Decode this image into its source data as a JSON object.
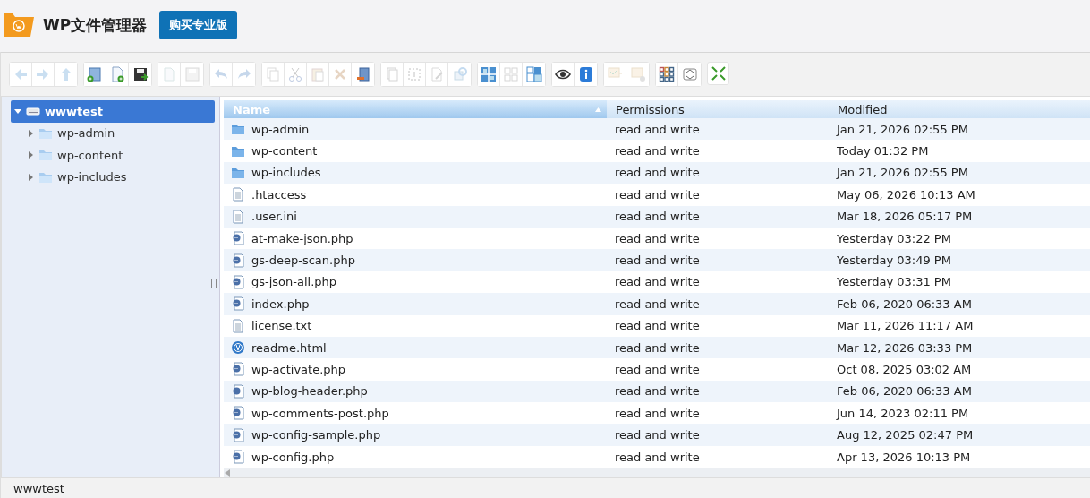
{
  "app": {
    "title": "WP文件管理器",
    "upgrade_button": "购买专业版"
  },
  "toolbar": [
    [
      {
        "kind": "back",
        "disabled": true
      },
      {
        "kind": "forward",
        "disabled": true
      },
      {
        "kind": "up",
        "disabled": true
      }
    ],
    [
      {
        "kind": "new-folder",
        "disabled": false
      },
      {
        "kind": "new-file",
        "disabled": false
      },
      {
        "kind": "save",
        "disabled": false
      }
    ],
    [
      {
        "kind": "open",
        "disabled": true
      },
      {
        "kind": "download",
        "disabled": true
      }
    ],
    [
      {
        "kind": "undo",
        "disabled": true
      },
      {
        "kind": "redo",
        "disabled": true
      }
    ],
    [
      {
        "kind": "copy",
        "disabled": true
      },
      {
        "kind": "cut",
        "disabled": true
      },
      {
        "kind": "paste",
        "disabled": true
      },
      {
        "kind": "delete",
        "disabled": true
      },
      {
        "kind": "empty",
        "disabled": false
      }
    ],
    [
      {
        "kind": "duplicate",
        "disabled": true
      },
      {
        "kind": "select",
        "disabled": true
      },
      {
        "kind": "edit",
        "disabled": true
      },
      {
        "kind": "resize",
        "disabled": true
      }
    ],
    [
      {
        "kind": "icons",
        "disabled": false
      },
      {
        "kind": "deselect",
        "disabled": true
      },
      {
        "kind": "invert",
        "disabled": false
      }
    ],
    [
      {
        "kind": "view",
        "disabled": false
      },
      {
        "kind": "info",
        "disabled": false
      }
    ],
    [
      {
        "kind": "extract",
        "disabled": true
      },
      {
        "kind": "archive",
        "disabled": true
      }
    ],
    [
      {
        "kind": "grid",
        "disabled": false
      },
      {
        "kind": "sort",
        "disabled": false
      }
    ],
    [
      {
        "kind": "fullscreen",
        "disabled": false
      }
    ]
  ],
  "tree": [
    {
      "label": "wwwtest",
      "kind": "drive",
      "selected": true,
      "expanded": true,
      "children": [
        {
          "label": "wp-admin",
          "kind": "folder",
          "selected": false,
          "expanded": false
        },
        {
          "label": "wp-content",
          "kind": "folder",
          "selected": false,
          "expanded": false
        },
        {
          "label": "wp-includes",
          "kind": "folder",
          "selected": false,
          "expanded": false
        }
      ]
    }
  ],
  "table": {
    "columns": [
      {
        "label": "Name",
        "sorted": true
      },
      {
        "label": "Permissions",
        "sorted": false
      },
      {
        "label": "Modified",
        "sorted": false
      }
    ],
    "rows": [
      {
        "kind": "folder",
        "name": "wp-admin",
        "permissions": "read and write",
        "modified": "Jan 21, 2026 02:55 PM"
      },
      {
        "kind": "folder",
        "name": "wp-content",
        "permissions": "read and write",
        "modified": "Today 01:32 PM"
      },
      {
        "kind": "folder",
        "name": "wp-includes",
        "permissions": "read and write",
        "modified": "Jan 21, 2026 02:55 PM"
      },
      {
        "kind": "text",
        "name": ".htaccess",
        "permissions": "read and write",
        "modified": "May 06, 2026 10:13 AM"
      },
      {
        "kind": "text",
        "name": ".user.ini",
        "permissions": "read and write",
        "modified": "Mar 18, 2026 05:17 PM"
      },
      {
        "kind": "php",
        "name": "at-make-json.php",
        "permissions": "read and write",
        "modified": "Yesterday 03:22 PM"
      },
      {
        "kind": "php",
        "name": "gs-deep-scan.php",
        "permissions": "read and write",
        "modified": "Yesterday 03:49 PM"
      },
      {
        "kind": "php",
        "name": "gs-json-all.php",
        "permissions": "read and write",
        "modified": "Yesterday 03:31 PM"
      },
      {
        "kind": "php",
        "name": "index.php",
        "permissions": "read and write",
        "modified": "Feb 06, 2020 06:33 AM"
      },
      {
        "kind": "text",
        "name": "license.txt",
        "permissions": "read and write",
        "modified": "Mar 11, 2026 11:17 AM"
      },
      {
        "kind": "html",
        "name": "readme.html",
        "permissions": "read and write",
        "modified": "Mar 12, 2026 03:33 PM"
      },
      {
        "kind": "php",
        "name": "wp-activate.php",
        "permissions": "read and write",
        "modified": "Oct 08, 2025 03:02 AM"
      },
      {
        "kind": "php",
        "name": "wp-blog-header.php",
        "permissions": "read and write",
        "modified": "Feb 06, 2020 06:33 AM"
      },
      {
        "kind": "php",
        "name": "wp-comments-post.php",
        "permissions": "read and write",
        "modified": "Jun 14, 2023 02:11 PM"
      },
      {
        "kind": "php",
        "name": "wp-config-sample.php",
        "permissions": "read and write",
        "modified": "Aug 12, 2025 02:47 PM"
      },
      {
        "kind": "php",
        "name": "wp-config.php",
        "permissions": "read and write",
        "modified": "Apr 13, 2026 10:13 PM"
      }
    ]
  },
  "status_bar": {
    "path": "wwwtest"
  }
}
